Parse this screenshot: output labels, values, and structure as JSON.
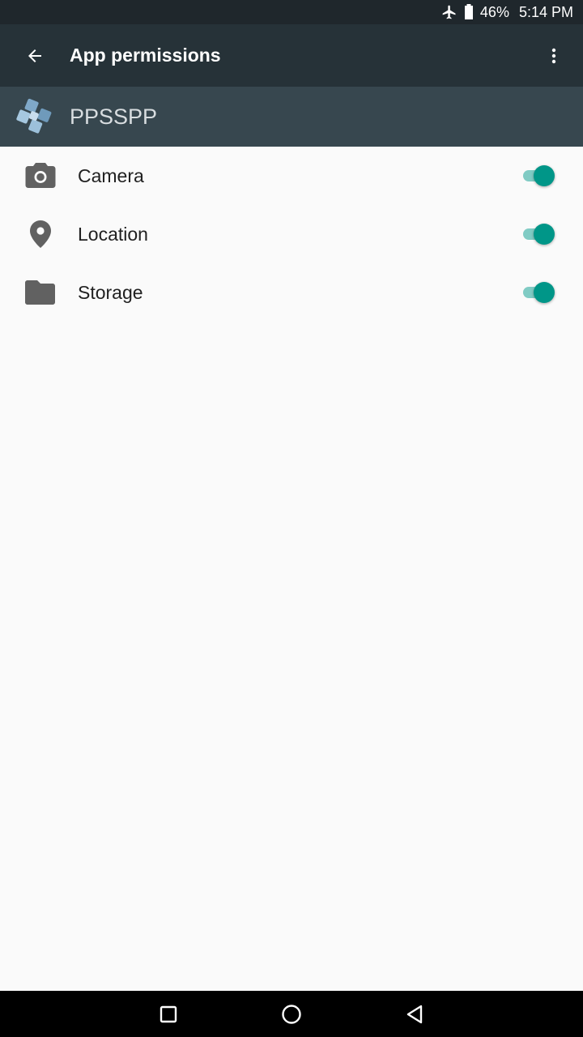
{
  "status_bar": {
    "battery_percent": "46%",
    "time": "5:14 PM",
    "icons": [
      "airplane-mode-icon",
      "battery-icon"
    ]
  },
  "app_bar": {
    "title": "App permissions",
    "back_icon": "arrow-back-icon",
    "overflow_icon": "more-vert-icon"
  },
  "app_header": {
    "app_name": "PPSSPP",
    "app_icon": "ppsspp-logo"
  },
  "permissions": [
    {
      "label": "Camera",
      "icon": "camera-icon",
      "enabled": true
    },
    {
      "label": "Location",
      "icon": "location-pin-icon",
      "enabled": true
    },
    {
      "label": "Storage",
      "icon": "folder-icon",
      "enabled": true
    }
  ],
  "nav_bar": {
    "buttons": [
      "recents-square-icon",
      "home-circle-icon",
      "back-triangle-icon"
    ]
  },
  "colors": {
    "status_bar": "#1f272c",
    "app_bar": "#263238",
    "app_header": "#37474f",
    "toggle_on_thumb": "#009688",
    "toggle_on_track": "#80cbc4",
    "icon_gray": "#616161"
  }
}
